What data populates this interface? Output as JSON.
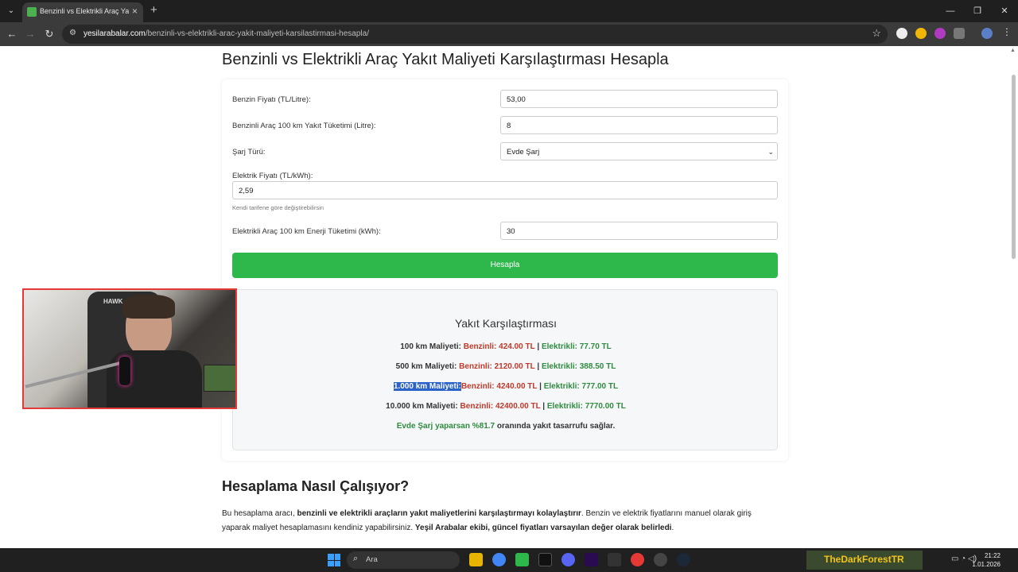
{
  "browser": {
    "tab_title": "Benzinli vs Elektrikli Araç Yakıt M",
    "url_host": "yesilarabalar.com",
    "url_path": "/benzinli-vs-elektrikli-arac-yakit-maliyeti-karsilastirmasi-hesapla/"
  },
  "page": {
    "title": "Benzinli vs Elektrikli Araç Yakıt Maliyeti Karşılaştırması Hesapla",
    "form": {
      "gas_price_label": "Benzin Fiyatı (TL/Litre):",
      "gas_price_value": "53,00",
      "gas_consumption_label": "Benzinli Araç 100 km Yakıt Tüketimi (Litre):",
      "gas_consumption_value": "8",
      "charge_type_label": "Şarj Türü:",
      "charge_type_value": "Evde Şarj",
      "electric_price_label": "Elektrik Fiyatı (TL/kWh):",
      "electric_price_value": "2,59",
      "electric_price_hint": "Kendi tarifene göre değiştirebilirsin",
      "ev_consumption_label": "Elektrikli Araç 100 km Enerji Tüketimi (kWh):",
      "ev_consumption_value": "30",
      "calculate_button": "Hesapla"
    },
    "results": {
      "title": "Yakıt Karşılaştırması",
      "rows": [
        {
          "label": "100 km Maliyeti:",
          "petrol": "Benzinli: 424.00 TL",
          "sep": "|",
          "electric": "Elektrikli: 77.70 TL"
        },
        {
          "label": "500 km Maliyeti:",
          "petrol": "Benzinli: 2120.00 TL",
          "sep": "|",
          "electric": "Elektrikli: 388.50 TL"
        },
        {
          "label": "1.000 km Maliyeti:",
          "petrol": "Benzinli: 4240.00 TL",
          "sep": "|",
          "electric": "Elektrikli: 777.00 TL"
        },
        {
          "label": "10.000 km Maliyeti:",
          "petrol": "Benzinli: 42400.00 TL",
          "sep": "|",
          "electric": "Elektrikli: 7770.00 TL"
        }
      ],
      "savings_highlight": "Evde Şarj yaparsan %81.7",
      "savings_rest": "oranında yakıt tasarrufu sağlar."
    },
    "section_title": "Hesaplama Nasıl Çalışıyor?",
    "paragraph": {
      "p1": "Bu hesaplama aracı,",
      "b1": "benzinli ve elektrikli araçların yakıt maliyetlerini karşılaştırmayı kolaylaştırır",
      "p2": ". Benzin ve elektrik fiyatlarını manuel olarak giriş yaparak maliyet hesaplamasını kendiniz yapabilirsiniz.",
      "b2": "Yeşil Arabalar ekibi, güncel fiyatları varsayılan değer olarak belirledi",
      "p3": "."
    }
  },
  "webcam": {
    "chair_brand": "HAWK"
  },
  "taskbar": {
    "search_placeholder": "Ara",
    "streamer_name": "TheDarkForestTR",
    "time": "21:22",
    "date": "1.01.2026"
  },
  "colors": {
    "accent_green": "#2eb84c",
    "petrol_red": "#c0392b",
    "electric_green": "#2e8b3f",
    "selection_blue": "#2b63c9"
  }
}
